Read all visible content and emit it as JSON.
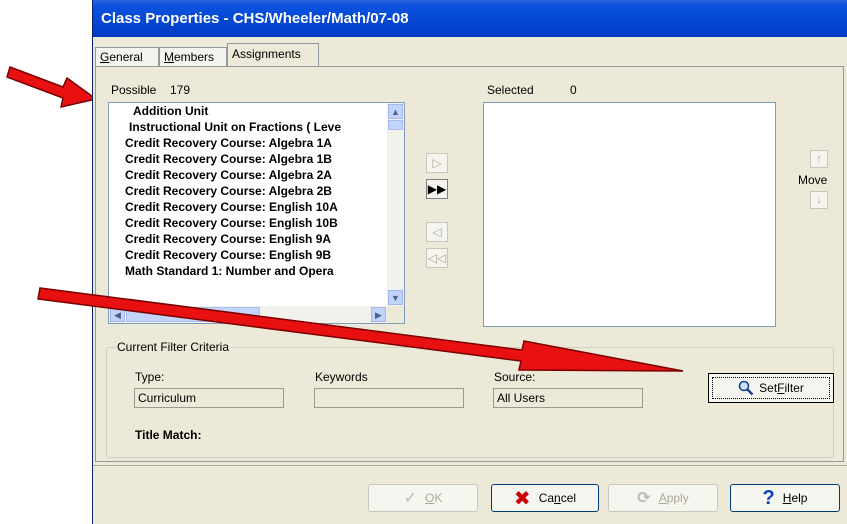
{
  "window": {
    "title": "Class Properties - CHS/Wheeler/Math/07-08"
  },
  "tabs": [
    {
      "label": "General",
      "accel": "G",
      "rest": "eneral"
    },
    {
      "label": "Members",
      "accel": "M",
      "rest": "embers"
    },
    {
      "label": "Assignments"
    }
  ],
  "possible": {
    "label": "Possible",
    "count": "179",
    "items": [
      " Addition Unit",
      " Instructional Unit on Fractions ( Leve",
      "Credit Recovery Course: Algebra 1A",
      "Credit Recovery Course: Algebra 1B",
      "Credit Recovery Course: Algebra 2A",
      "Credit Recovery Course: Algebra 2B",
      "Credit Recovery Course: English 10A",
      "Credit Recovery Course: English 10B",
      "Credit Recovery Course: English 9A",
      "Credit Recovery Course: English 9B",
      "Math Standard 1: Number and Opera"
    ]
  },
  "selected": {
    "label": "Selected",
    "count": "0"
  },
  "transfer": {
    "add": "▷",
    "add_all": "▶▶",
    "remove": "◁",
    "remove_all": "◁◁"
  },
  "move": {
    "label": "Move",
    "up": "↑",
    "down": "↓"
  },
  "filter": {
    "group_title": "Current Filter Criteria",
    "type_label": "Type:",
    "type_value": "Curriculum",
    "keywords_label": "Keywords",
    "keywords_value": "",
    "source_label": "Source:",
    "source_value": "All Users",
    "title_match_label": "Title Match:",
    "set_filter_pre": "Set ",
    "set_filter_accel": "F",
    "set_filter_post": "ilter"
  },
  "buttons": {
    "ok_accel": "O",
    "ok_rest": "K",
    "cancel_pre": "Ca",
    "cancel_accel": "n",
    "cancel_post": "cel",
    "apply_accel": "A",
    "apply_rest": "pply",
    "help_accel": "H",
    "help_rest": "elp"
  },
  "icons": {
    "ok": "checkmark-icon",
    "cancel": "red-x-icon",
    "apply": "refresh-icon",
    "help": "question-mark-icon",
    "filter": "magnifier-icon"
  },
  "colors": {
    "titlebar": "#0546d0",
    "annotation_arrow": "#e81010",
    "cancel_icon": "#cc0000",
    "help_icon": "#0a3fb5"
  }
}
